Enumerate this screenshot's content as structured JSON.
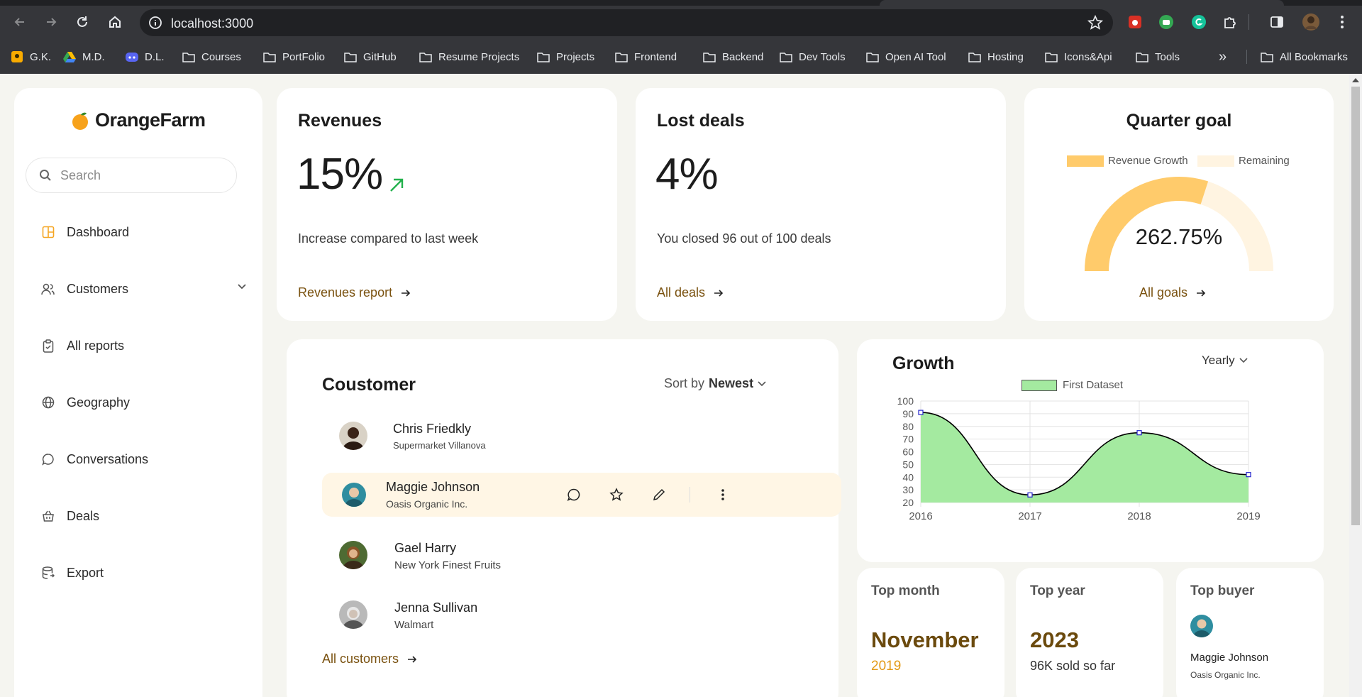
{
  "browser": {
    "url": "localhost:3000",
    "bookmarks": [
      "G.K.",
      "M.D.",
      "D.L.",
      "Courses",
      "PortFolio",
      "GitHub",
      "Resume Projects",
      "Projects",
      "Frontend",
      "Backend",
      "Dev Tools",
      "Open AI Tool",
      "Hosting",
      "Icons&Api",
      "Tools"
    ],
    "all_bookmarks": "All Bookmarks",
    "more": "»"
  },
  "brand": {
    "name": "OrangeFarm"
  },
  "search": {
    "placeholder": "Search"
  },
  "sidebar": {
    "items": [
      {
        "label": "Dashboard",
        "icon": "dashboard-icon",
        "active": true
      },
      {
        "label": "Customers",
        "icon": "users-icon"
      },
      {
        "label": "All reports",
        "icon": "clipboard-icon"
      },
      {
        "label": "Geography",
        "icon": "globe-icon"
      },
      {
        "label": "Conversations",
        "icon": "chat-icon"
      },
      {
        "label": "Deals",
        "icon": "basket-icon"
      },
      {
        "label": "Export",
        "icon": "database-export-icon"
      }
    ]
  },
  "revenues": {
    "title": "Revenues",
    "value": "15%",
    "description": "Increase compared to last week",
    "link": "Revenues report"
  },
  "lost_deals": {
    "title": "Lost deals",
    "value": "4%",
    "description": "You closed 96 out of 100 deals",
    "link": "All deals"
  },
  "quarter_goal": {
    "title": "Quarter goal",
    "legend": [
      "Revenue Growth",
      "Remaining"
    ],
    "value": "262.75%",
    "filled_fraction": 0.6,
    "link": "All goals",
    "colors": {
      "filled": "#ffcb6b",
      "remaining": "#fff4e1"
    }
  },
  "customers": {
    "title": "Coustomer",
    "sort_label": "Sort by",
    "sort_value": "Newest",
    "link": "All customers",
    "rows": [
      {
        "name": "Chris Friedkly",
        "company": "Supermarket Villanova"
      },
      {
        "name": "Maggie Johnson",
        "company": "Oasis Organic Inc."
      },
      {
        "name": "Gael Harry",
        "company": "New York Finest Fruits"
      },
      {
        "name": "Jenna Sullivan",
        "company": "Walmart"
      }
    ]
  },
  "growth": {
    "title": "Growth",
    "period": "Yearly",
    "legend": "First Dataset",
    "y_ticks": [
      "100",
      "90",
      "80",
      "70",
      "60",
      "50",
      "40",
      "30",
      "20"
    ],
    "x_ticks": [
      "2016",
      "2017",
      "2018",
      "2019"
    ]
  },
  "chart_data": {
    "type": "area",
    "x": [
      "2016",
      "2017",
      "2018",
      "2019"
    ],
    "series": [
      {
        "name": "First Dataset",
        "values": [
          91,
          26,
          75,
          42
        ]
      }
    ],
    "ylim": [
      20,
      100
    ],
    "grid": true,
    "legend": "top",
    "colors": {
      "fill": "#a4eaa0",
      "line": "#000000",
      "point": "#2222cc"
    }
  },
  "top_month": {
    "title": "Top month",
    "value": "November",
    "sub": "2019"
  },
  "top_year": {
    "title": "Top year",
    "value": "2023",
    "sub": "96K sold so far"
  },
  "top_buyer": {
    "title": "Top buyer",
    "name": "Maggie Johnson",
    "company": "Oasis Organic Inc."
  },
  "colors": {
    "accent": "#f5a623",
    "link": "#7a5210",
    "highlight_row": "#fff6e5",
    "up_arrow": "#22b14c"
  }
}
